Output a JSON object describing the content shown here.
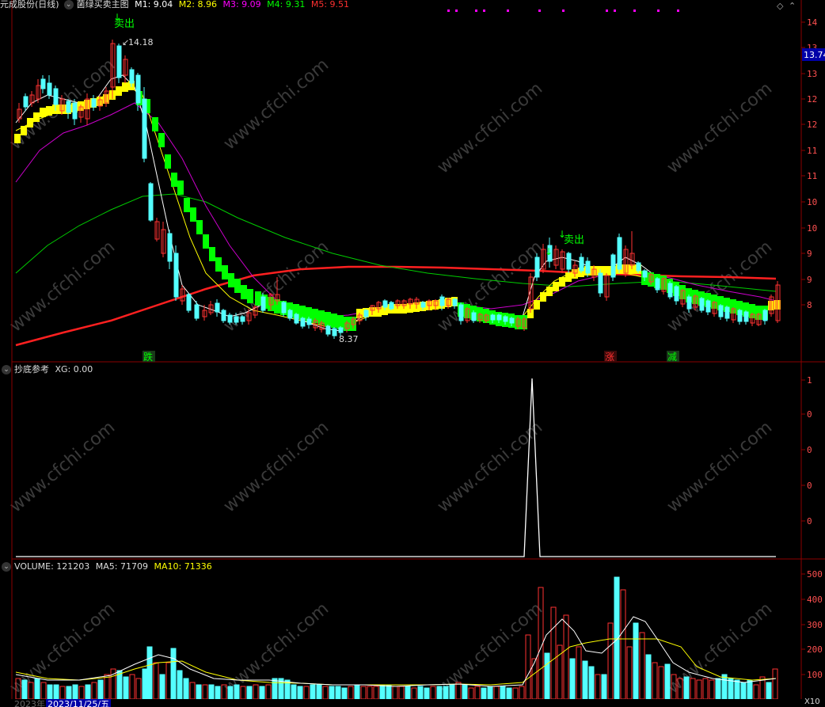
{
  "main_panel": {
    "stock_title": "元成股份(日线)",
    "indicator_name": "菌绿买卖主图",
    "ma_labels": [
      {
        "text": "M1: 9.04",
        "color": "#ffffff"
      },
      {
        "text": "M2: 8.96",
        "color": "#ffff00"
      },
      {
        "text": "M3: 9.09",
        "color": "#ff00ff"
      },
      {
        "text": "M4: 9.31",
        "color": "#00ff00"
      },
      {
        "text": "M5: 9.51",
        "color": "#ff3030"
      }
    ],
    "price_axis": [
      "14",
      "13",
      "13",
      "12",
      "12",
      "11",
      "11",
      "10",
      "10",
      "9",
      "9",
      "8"
    ],
    "current_price": "13.74",
    "high_label": "14.18",
    "low_label": "8.37",
    "sell_label_1": "卖出",
    "sell_label_2": "卖出",
    "signal_die": "跌",
    "signal_zhang": "涨",
    "signal_jian": "减"
  },
  "sub_panel": {
    "name": "抄底参考",
    "value": "XG: 0.00",
    "axis": [
      "1",
      "0",
      "0",
      "0",
      "0"
    ]
  },
  "volume_panel": {
    "volume": "VOLUME: 121203",
    "ma5": "MA5: 71709",
    "ma10": "MA10: 71336",
    "axis": [
      "500",
      "400",
      "300",
      "200",
      "100"
    ],
    "unit": "X10"
  },
  "date_bar": {
    "start": "2023年",
    "cursor_date": "2023/11/25/五"
  },
  "watermark": "www.cfchi.com",
  "colors": {
    "up": "#ff3232",
    "down": "#54ffff",
    "grid": "#8b0000",
    "green_band": "#00ff00",
    "yellow_band": "#ffff00"
  }
}
